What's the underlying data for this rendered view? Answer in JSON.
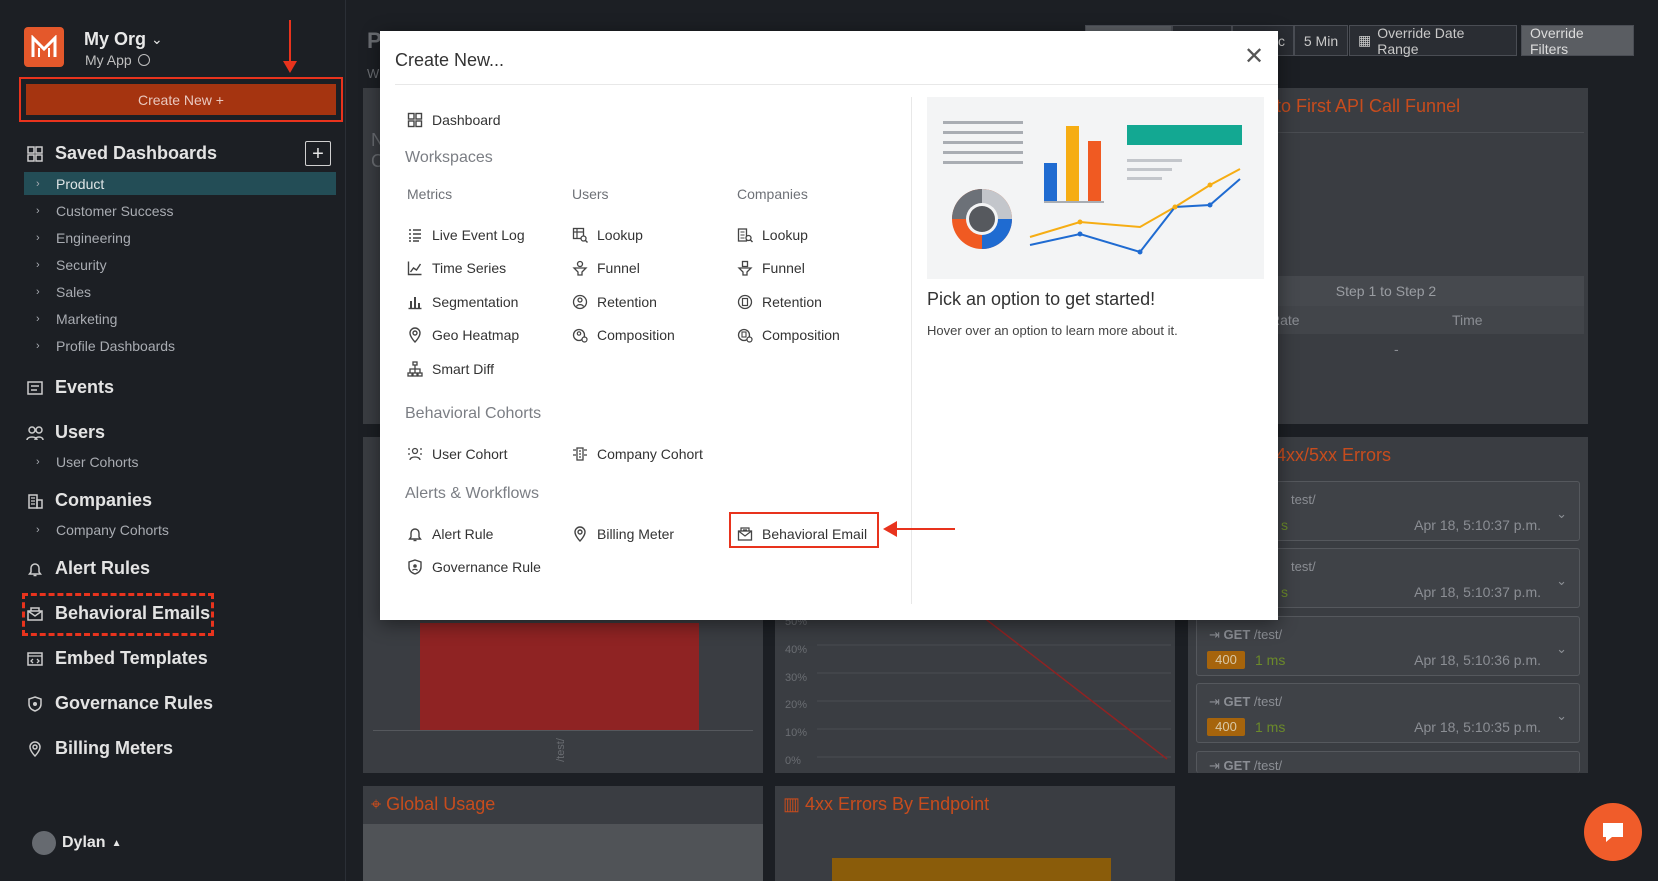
{
  "sidebar": {
    "org_name": "My Org",
    "app_name": "My App",
    "create_button": "Create New +",
    "saved_dashboards": "Saved Dashboards",
    "dashboards": [
      "Product",
      "Customer Success",
      "Engineering",
      "Security",
      "Sales",
      "Marketing",
      "Profile Dashboards"
    ],
    "events": "Events",
    "users": "Users",
    "user_cohorts": "User Cohorts",
    "companies": "Companies",
    "company_cohorts": "Company Cohorts",
    "alert_rules": "Alert Rules",
    "behavioral_emails": "Behavioral Emails",
    "embed_templates": "Embed Templates",
    "governance_rules": "Governance Rules",
    "billing_meters": "Billing Meters",
    "user_name": "Dylan"
  },
  "topbar": {
    "range_partial": "c",
    "five_min": "5 Min",
    "override_date": "Override Date Range",
    "override_filters": "Override Filters"
  },
  "background": {
    "funnel_title_partial": "tion to First API Call Funnel",
    "step_label": "Step 1 to Step 2",
    "rate_partial": "Rate",
    "time_label": "Time",
    "dash": "-",
    "errors_title_partial": "4xx/5xx Errors",
    "global_usage": "Global Usage",
    "errors_by_endpoint": "4xx Errors By Endpoint",
    "bar_axis_label": "/test/",
    "y_ticks": [
      "50%",
      "40%",
      "30%",
      "20%",
      "10%",
      "0%"
    ],
    "error_rows": [
      {
        "method": "",
        "path": "test/",
        "code": "",
        "ms": "s",
        "time": "Apr 18, 5:10:37 p.m."
      },
      {
        "method": "",
        "path": "test/",
        "code": "",
        "ms": "s",
        "time": "Apr 18, 5:10:37 p.m."
      },
      {
        "method": "GET",
        "path": "/test/",
        "code": "400",
        "ms": "1 ms",
        "time": "Apr 18, 5:10:36 p.m."
      },
      {
        "method": "GET",
        "path": "/test/",
        "code": "400",
        "ms": "1 ms",
        "time": "Apr 18, 5:10:35 p.m."
      },
      {
        "method": "GET",
        "path": "/test/",
        "code": "",
        "ms": "",
        "time": ""
      }
    ]
  },
  "modal": {
    "title": "Create New...",
    "dashboard": "Dashboard",
    "workspaces": "Workspaces",
    "metrics": "Metrics",
    "users_col": "Users",
    "companies_col": "Companies",
    "metrics_items": [
      "Live Event Log",
      "Time Series",
      "Segmentation",
      "Geo Heatmap",
      "Smart Diff"
    ],
    "users_items": [
      "Lookup",
      "Funnel",
      "Retention",
      "Composition"
    ],
    "companies_items": [
      "Lookup",
      "Funnel",
      "Retention",
      "Composition"
    ],
    "behavioral_cohorts": "Behavioral Cohorts",
    "user_cohort": "User Cohort",
    "company_cohort": "Company Cohort",
    "alerts_workflows": "Alerts & Workflows",
    "alert_rule": "Alert Rule",
    "billing_meter": "Billing Meter",
    "behavioral_email": "Behavioral Email",
    "governance_rule": "Governance Rule",
    "pick_title": "Pick an option to get started!",
    "pick_desc": "Hover over an option to learn more about it."
  }
}
